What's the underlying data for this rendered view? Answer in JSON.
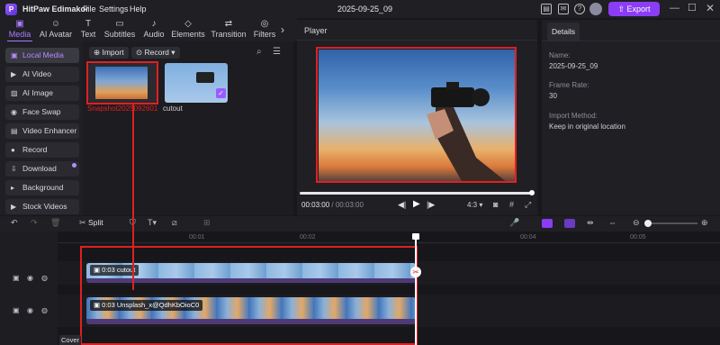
{
  "titlebar": {
    "app_name": "HitPaw Edimakor",
    "menu": [
      "File",
      "Settings",
      "Help"
    ],
    "project_name": "2025-09-25_09",
    "export_label": "Export"
  },
  "toolbar": {
    "tools": [
      {
        "label": "Media",
        "icon": "folder-icon"
      },
      {
        "label": "AI Avatar",
        "icon": "avatar-icon"
      },
      {
        "label": "Text",
        "icon": "text-icon"
      },
      {
        "label": "Subtitles",
        "icon": "subtitles-icon"
      },
      {
        "label": "Audio",
        "icon": "music-icon"
      },
      {
        "label": "Elements",
        "icon": "elements-icon"
      },
      {
        "label": "Transition",
        "icon": "transition-icon"
      },
      {
        "label": "Filters",
        "icon": "filters-icon"
      }
    ]
  },
  "sidebar": {
    "items": [
      {
        "label": "Local Media"
      },
      {
        "label": "AI Video"
      },
      {
        "label": "AI Image"
      },
      {
        "label": "Face Swap"
      },
      {
        "label": "Video Enhancer"
      },
      {
        "label": "Record"
      },
      {
        "label": "Download"
      },
      {
        "label": "Background"
      },
      {
        "label": "Stock Videos"
      }
    ]
  },
  "media": {
    "import_label": "Import",
    "record_label": "Record",
    "items": [
      {
        "name": "Snapshot2025092601"
      },
      {
        "name": "cutout"
      }
    ]
  },
  "player": {
    "title": "Player",
    "time_current": "00:03:00",
    "time_total": "00:03:00",
    "time_sep": " / ",
    "aspect": "4:3"
  },
  "details": {
    "tab": "Details",
    "name_label": "Name:",
    "name_value": "2025-09-25_09",
    "frame_label": "Frame Rate:",
    "frame_value": "30",
    "import_label": "Import Method:",
    "import_value": "Keep in original location"
  },
  "timeline": {
    "split_label": "Split",
    "ruler": [
      "00:01",
      "00:02",
      "00:04",
      "00:05"
    ],
    "clip1": {
      "duration": "0:03",
      "name": "cutout"
    },
    "clip2": {
      "duration": "0:03",
      "name": "Unsplash_x@QdhKbOioC0"
    },
    "cover_label": "Cover"
  },
  "colors": {
    "accent": "#8b3df5",
    "highlight": "#e02020"
  }
}
